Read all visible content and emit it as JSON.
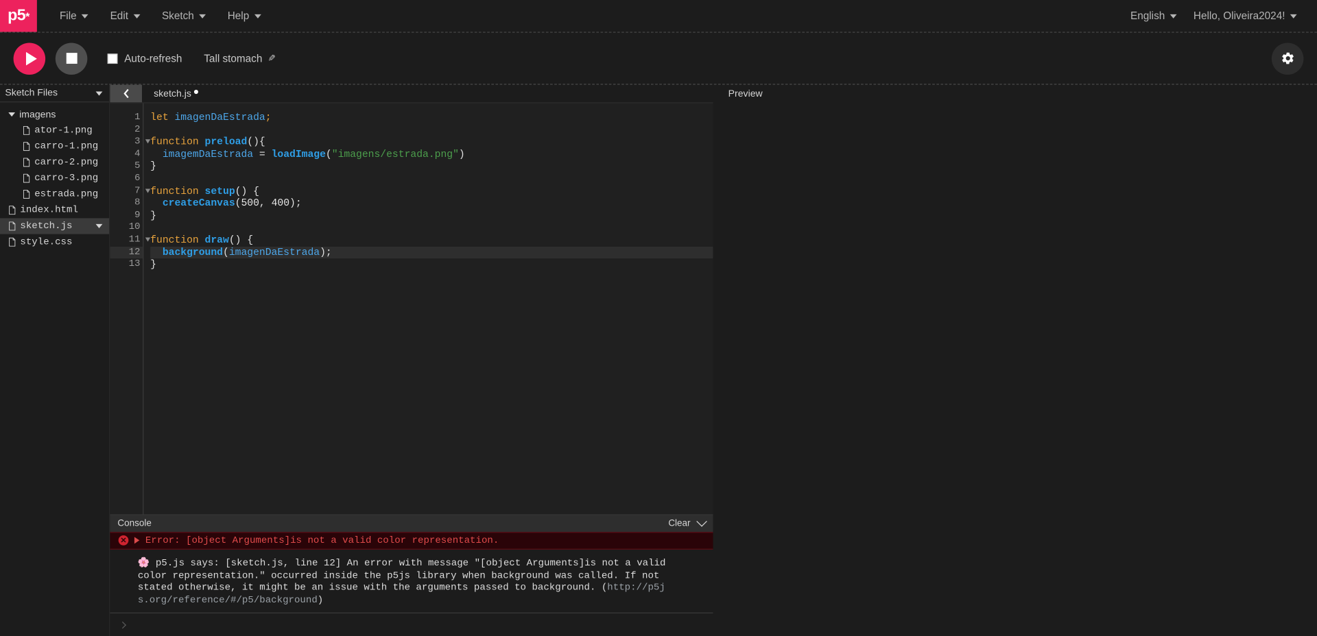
{
  "navbar": {
    "logo": "p5",
    "logo_sup": "*",
    "menus": [
      {
        "label": "File",
        "icon": "chevron-down-icon"
      },
      {
        "label": "Edit",
        "icon": "chevron-down-icon"
      },
      {
        "label": "Sketch",
        "icon": "chevron-down-icon"
      },
      {
        "label": "Help",
        "icon": "chevron-down-icon"
      }
    ],
    "language": "English",
    "account": "Hello, Oliveira2024!"
  },
  "toolbar": {
    "play_label": "play-button",
    "stop_label": "stop-button",
    "autorefresh_label": "Auto-refresh",
    "autorefresh_checked": false,
    "sketch_name": "Tall stomach",
    "pencil_icon": "✎",
    "settings_icon": "gear-icon"
  },
  "sidebar": {
    "header": "Sketch Files",
    "tree": [
      {
        "label": "imagens",
        "type": "folder",
        "depth": 0,
        "expanded": true,
        "selected": false
      },
      {
        "label": "ator-1.png",
        "type": "file",
        "depth": 1,
        "selected": false
      },
      {
        "label": "carro-1.png",
        "type": "file",
        "depth": 1,
        "selected": false
      },
      {
        "label": "carro-2.png",
        "type": "file",
        "depth": 1,
        "selected": false
      },
      {
        "label": "carro-3.png",
        "type": "file",
        "depth": 1,
        "selected": false
      },
      {
        "label": "estrada.png",
        "type": "file",
        "depth": 1,
        "selected": false
      },
      {
        "label": "index.html",
        "type": "file",
        "depth": 0,
        "selected": false
      },
      {
        "label": "sketch.js",
        "type": "file",
        "depth": 0,
        "selected": true
      },
      {
        "label": "style.css",
        "type": "file",
        "depth": 0,
        "selected": false
      }
    ]
  },
  "editor": {
    "collapse_icon": "chevron-left-icon",
    "tab_label": "sketch.js",
    "unsaved": true,
    "active_line": 12,
    "fold_lines": [
      3,
      7,
      11
    ],
    "lines": [
      {
        "n": 1,
        "tokens": [
          {
            "t": "let",
            "c": "kw"
          },
          {
            "t": " ",
            "c": "punc"
          },
          {
            "t": "imagenDaEstrada",
            "c": "var"
          },
          {
            "t": ";",
            "c": "kw"
          }
        ]
      },
      {
        "n": 2,
        "tokens": []
      },
      {
        "n": 3,
        "tokens": [
          {
            "t": "function",
            "c": "kw"
          },
          {
            "t": " ",
            "c": "punc"
          },
          {
            "t": "preload",
            "c": "fn"
          },
          {
            "t": "(){",
            "c": "punc"
          }
        ]
      },
      {
        "n": 4,
        "tokens": [
          {
            "t": "  ",
            "c": "punc"
          },
          {
            "t": "imagemDaEstrada",
            "c": "var"
          },
          {
            "t": " = ",
            "c": "punc"
          },
          {
            "t": "loadImage",
            "c": "fn"
          },
          {
            "t": "(",
            "c": "punc"
          },
          {
            "t": "\"imagens/estrada.png\"",
            "c": "str"
          },
          {
            "t": ")",
            "c": "punc"
          }
        ]
      },
      {
        "n": 5,
        "tokens": [
          {
            "t": "}",
            "c": "punc"
          }
        ]
      },
      {
        "n": 6,
        "tokens": []
      },
      {
        "n": 7,
        "tokens": [
          {
            "t": "function",
            "c": "kw"
          },
          {
            "t": " ",
            "c": "punc"
          },
          {
            "t": "setup",
            "c": "fn"
          },
          {
            "t": "() {",
            "c": "punc"
          }
        ]
      },
      {
        "n": 8,
        "tokens": [
          {
            "t": "  ",
            "c": "punc"
          },
          {
            "t": "createCanvas",
            "c": "fn"
          },
          {
            "t": "(",
            "c": "punc"
          },
          {
            "t": "500",
            "c": "num"
          },
          {
            "t": ", ",
            "c": "punc"
          },
          {
            "t": "400",
            "c": "num"
          },
          {
            "t": ");",
            "c": "punc"
          }
        ]
      },
      {
        "n": 9,
        "tokens": [
          {
            "t": "}",
            "c": "punc"
          }
        ]
      },
      {
        "n": 10,
        "tokens": []
      },
      {
        "n": 11,
        "tokens": [
          {
            "t": "function",
            "c": "kw"
          },
          {
            "t": " ",
            "c": "punc"
          },
          {
            "t": "draw",
            "c": "fn"
          },
          {
            "t": "() {",
            "c": "punc"
          }
        ]
      },
      {
        "n": 12,
        "tokens": [
          {
            "t": "  ",
            "c": "punc"
          },
          {
            "t": "background",
            "c": "fn"
          },
          {
            "t": "(",
            "c": "punc"
          },
          {
            "t": "imagenDaEstrada",
            "c": "var"
          },
          {
            "t": ");",
            "c": "punc"
          }
        ]
      },
      {
        "n": 13,
        "tokens": [
          {
            "t": "}",
            "c": "punc"
          }
        ]
      }
    ]
  },
  "console": {
    "title": "Console",
    "clear_label": "Clear",
    "collapse_icon": "chevron-down-icon",
    "error": {
      "icon": "error-circle-icon",
      "expand_icon": "triangle-right-icon",
      "summary": "Error: [object Arguments]is not a valid color representation.",
      "flower": "🌸",
      "detail": "p5.js says: [sketch.js, line 12] An error with message \"[object Arguments]is not a valid color representation.\" occurred inside the p5js library when background was called. If not stated otherwise, it might be an issue with the arguments passed to background. (",
      "detail_link": "http://p5js.org/reference/#/p5/background",
      "detail_end": ")"
    },
    "prompt": "›"
  },
  "preview": {
    "title": "Preview"
  },
  "colors": {
    "brand_pink": "#ed225d",
    "bg_dark": "#1c1c1c",
    "editor_bg": "#202020",
    "error_bg": "#2a0408",
    "error_text": "#e04b4b"
  }
}
